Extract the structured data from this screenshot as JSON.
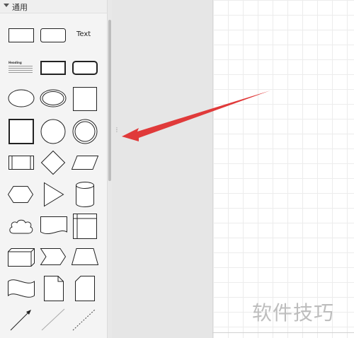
{
  "panel": {
    "title": "通用",
    "shapes": {
      "text_label": "Text",
      "textbox_heading": "Heading"
    }
  },
  "watermark": "软件技巧",
  "colors": {
    "annotation_arrow": "#e03a3a",
    "shape_stroke": "#222222",
    "panel_bg": "#f4f4f4",
    "gutter_bg": "#e6e6e6"
  },
  "icons": {
    "collapse": "chevron-handle"
  }
}
